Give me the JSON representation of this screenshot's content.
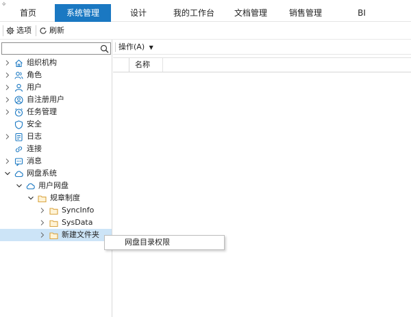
{
  "nav": {
    "tabs": [
      {
        "label": "首页"
      },
      {
        "label": "系统管理"
      },
      {
        "label": "设计"
      },
      {
        "label": "我的工作台"
      },
      {
        "label": "文档管理"
      },
      {
        "label": "销售管理"
      },
      {
        "label": "BI"
      }
    ],
    "active_index": 1
  },
  "toolbar": {
    "options_label": "选项",
    "refresh_label": "刷新"
  },
  "search": {
    "value": "",
    "placeholder": ""
  },
  "tree": [
    {
      "label": "组织机构",
      "icon": "home-icon",
      "expand": "collapsed"
    },
    {
      "label": "角色",
      "icon": "users-icon",
      "expand": "collapsed"
    },
    {
      "label": "用户",
      "icon": "user-icon",
      "expand": "collapsed"
    },
    {
      "label": "自注册用户",
      "icon": "user-circle-icon",
      "expand": "collapsed"
    },
    {
      "label": "任务管理",
      "icon": "clock-icon",
      "expand": "collapsed"
    },
    {
      "label": "安全",
      "icon": "shield-icon",
      "expand": "none"
    },
    {
      "label": "日志",
      "icon": "log-icon",
      "expand": "collapsed"
    },
    {
      "label": "连接",
      "icon": "link-icon",
      "expand": "none"
    },
    {
      "label": "消息",
      "icon": "message-icon",
      "expand": "collapsed"
    },
    {
      "label": "网盘系统",
      "icon": "cloud-icon",
      "expand": "expanded"
    },
    {
      "label": "用户网盘",
      "icon": "cloud-icon",
      "expand": "expanded"
    },
    {
      "label": "规章制度",
      "icon": "folder-icon",
      "expand": "expanded"
    },
    {
      "label": "SyncInfo",
      "icon": "folder-icon",
      "expand": "collapsed"
    },
    {
      "label": "SysData",
      "icon": "folder-icon",
      "expand": "collapsed"
    },
    {
      "label": "新建文件夹",
      "icon": "folder-icon",
      "expand": "collapsed"
    }
  ],
  "right": {
    "ops_label": "操作(A)",
    "column_name": "名称"
  },
  "context_menu": {
    "items": [
      {
        "label": "网盘目录权限"
      }
    ]
  },
  "colors": {
    "accent": "#1a78c2",
    "selection": "#cce4f7",
    "folder": "#d9a441"
  }
}
